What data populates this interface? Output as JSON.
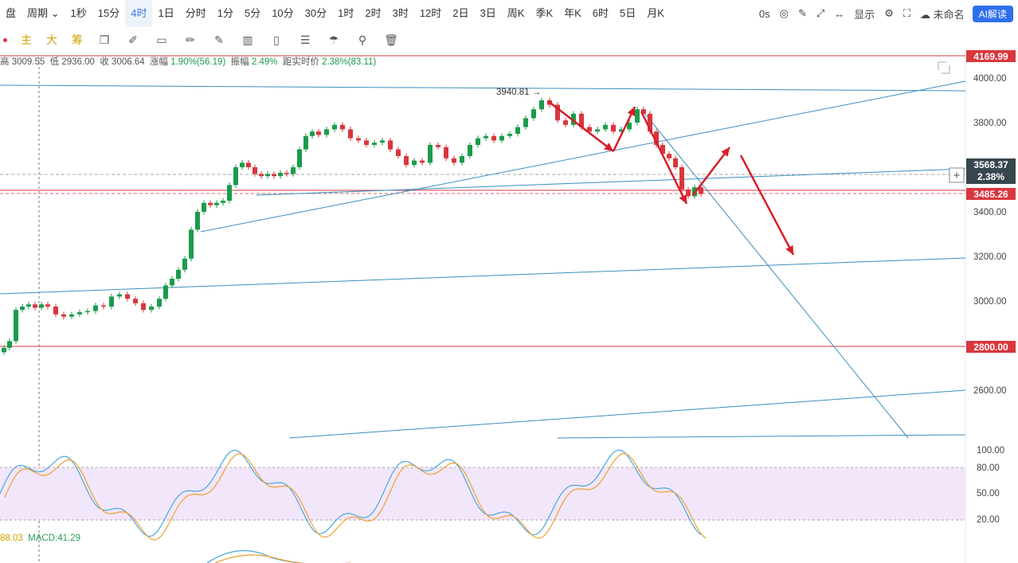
{
  "toolbar": {
    "items": [
      "盘",
      "周期",
      "1秒",
      "15分",
      "4时",
      "1日",
      "分时",
      "1分",
      "5分",
      "10分",
      "30分",
      "1时",
      "2时",
      "3时",
      "12时",
      "2日",
      "3日",
      "周K",
      "季K",
      "年K",
      "6时",
      "5日",
      "月K"
    ],
    "active_index": 4,
    "right": [
      "0s",
      "显示",
      "未命名",
      "AI解读"
    ]
  },
  "drawing_tools": {
    "labels": [
      "主",
      "大",
      "筹"
    ],
    "icons": [
      "copy-icon",
      "brush-icon",
      "rect-select-icon",
      "ruler-icon",
      "pencil-icon",
      "bar-icon",
      "doc-icon",
      "note-icon",
      "magnet-icon",
      "filter-icon",
      "trash-icon"
    ]
  },
  "info": {
    "high_label": "高",
    "high": "3009.55",
    "low_label": "低",
    "low": "2936.00",
    "close_label": "收",
    "close": "3006.64",
    "change_label": "涨幅",
    "change": "1.90%(56.19)",
    "amp_label": "振幅",
    "amp": "2.49%",
    "dist_label": "距实时价",
    "dist": "2.38%(83.11)"
  },
  "chart_data": {
    "type": "candlestick",
    "price_axis": {
      "ticks": [
        4000,
        3800,
        3600,
        3400,
        3200,
        3000,
        2800,
        2600
      ],
      "labels": [
        "4000.00",
        "3800.00",
        "3400.00",
        "3200.00",
        "3000.00",
        "2600.00"
      ]
    },
    "price_tags": [
      {
        "value": "4169.99",
        "color": "#d9363e"
      },
      {
        "value": "3568.37",
        "sub": "2.38%",
        "color": "#37474f"
      },
      {
        "value": "3485.26",
        "color": "#d9363e"
      },
      {
        "value": "2800.00",
        "color": "#d9363e"
      }
    ],
    "high_marker": "3940.81",
    "kdj_axis": [
      "100.00",
      "80.00",
      "50.00",
      "20.00"
    ],
    "macd_label": "MACD:41.29",
    "macd_prev": "88.03",
    "colors": {
      "up": "#1a9c4b",
      "down": "#d9363e",
      "trend": "#3a8fc0",
      "arrow": "#d81e2a",
      "kdj_bg": "#f2e6fb"
    }
  }
}
